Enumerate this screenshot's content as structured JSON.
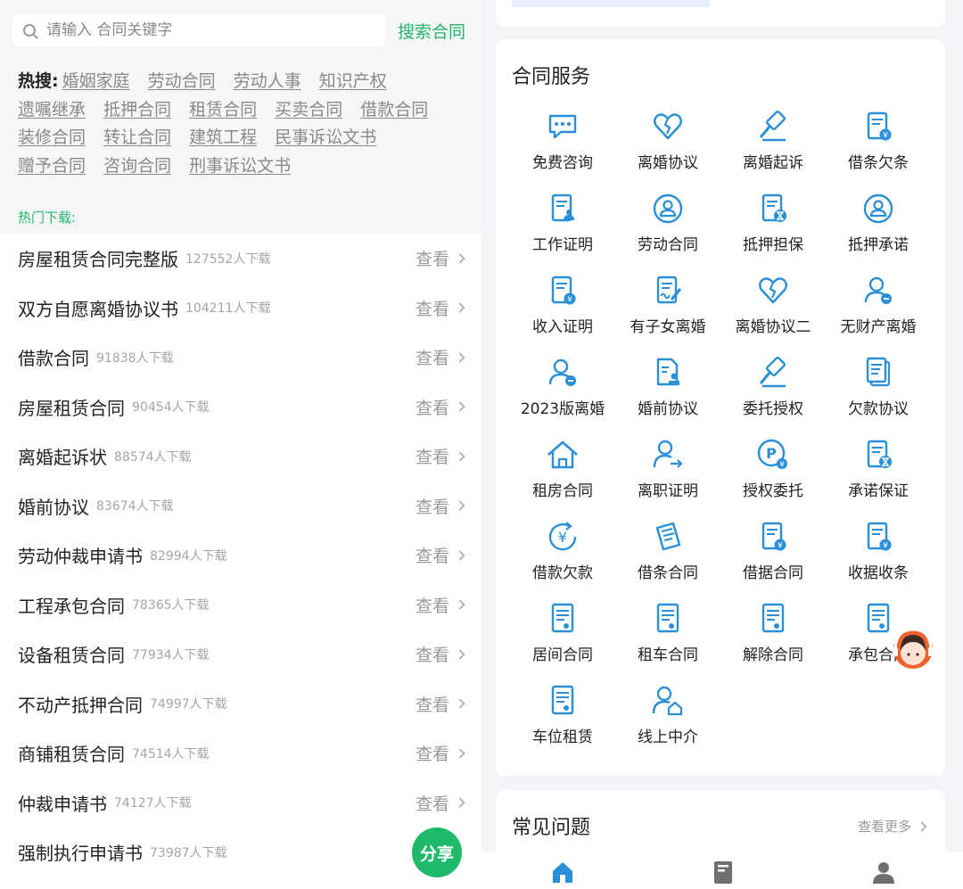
{
  "search": {
    "placeholder": "请输入 合同关键字",
    "button": "搜索合同"
  },
  "hot_search": {
    "label": "热搜:",
    "tags": [
      "婚姻家庭",
      "劳动合同",
      "劳动人事",
      "知识产权",
      "遗嘱继承",
      "抵押合同",
      "租赁合同",
      "买卖合同",
      "借款合同",
      "装修合同",
      "转让合同",
      "建筑工程",
      "民事诉讼文书",
      "赠予合同",
      "咨询合同",
      "刑事诉讼文书"
    ]
  },
  "hot_downloads": {
    "label": "热门下载:",
    "view_label": "查看",
    "items": [
      {
        "title": "房屋租赁合同完整版",
        "count": "127552人下载"
      },
      {
        "title": "双方自愿离婚协议书",
        "count": "104211人下载"
      },
      {
        "title": "借款合同",
        "count": "91838人下载"
      },
      {
        "title": "房屋租赁合同",
        "count": "90454人下载"
      },
      {
        "title": "离婚起诉状",
        "count": "88574人下载"
      },
      {
        "title": "婚前协议",
        "count": "83674人下载"
      },
      {
        "title": "劳动仲裁申请书",
        "count": "82994人下载"
      },
      {
        "title": "工程承包合同",
        "count": "78365人下载"
      },
      {
        "title": "设备租赁合同",
        "count": "77934人下载"
      },
      {
        "title": "不动产抵押合同",
        "count": "74997人下载"
      },
      {
        "title": "商铺租赁合同",
        "count": "74514人下载"
      },
      {
        "title": "仲裁申请书",
        "count": "74127人下载"
      },
      {
        "title": "强制执行申请书",
        "count": "73987人下载"
      }
    ],
    "share_label": "分享"
  },
  "contract_services": {
    "title": "合同服务",
    "items": [
      {
        "label": "免费咨询",
        "icon": "chat-icon"
      },
      {
        "label": "离婚协议",
        "icon": "broken-heart-icon"
      },
      {
        "label": "离婚起诉",
        "icon": "gavel-icon"
      },
      {
        "label": "借条欠条",
        "icon": "yen-document-icon"
      },
      {
        "label": "工作证明",
        "icon": "person-document-icon"
      },
      {
        "label": "劳动合同",
        "icon": "person-circle-icon"
      },
      {
        "label": "抵押担保",
        "icon": "hourglass-document-icon"
      },
      {
        "label": "抵押承诺",
        "icon": "person-circle-icon"
      },
      {
        "label": "收入证明",
        "icon": "yen-document-icon"
      },
      {
        "label": "有子女离婚",
        "icon": "signature-document-icon"
      },
      {
        "label": "离婚协议二",
        "icon": "broken-heart-icon"
      },
      {
        "label": "无财产离婚",
        "icon": "person-minus-icon"
      },
      {
        "label": "2023版离婚",
        "icon": "person-minus-icon"
      },
      {
        "label": "婚前协议",
        "icon": "stamp-document-icon"
      },
      {
        "label": "委托授权",
        "icon": "gavel-icon"
      },
      {
        "label": "欠款协议",
        "icon": "stacked-document-icon"
      },
      {
        "label": "租房合同",
        "icon": "house-icon"
      },
      {
        "label": "离职证明",
        "icon": "person-exit-icon"
      },
      {
        "label": "授权委托",
        "icon": "parking-icon"
      },
      {
        "label": "承诺保证",
        "icon": "hourglass-document-icon"
      },
      {
        "label": "借款欠款",
        "icon": "yen-cycle-icon"
      },
      {
        "label": "借条合同",
        "icon": "receipt-icon"
      },
      {
        "label": "借据合同",
        "icon": "yen-document-icon"
      },
      {
        "label": "收据收条",
        "icon": "yen-document-icon"
      },
      {
        "label": "居间合同",
        "icon": "certificate-icon"
      },
      {
        "label": "租车合同",
        "icon": "certificate-icon"
      },
      {
        "label": "解除合同",
        "icon": "certificate-icon"
      },
      {
        "label": "承包合同",
        "icon": "certificate-icon"
      },
      {
        "label": "车位租赁",
        "icon": "certificate-icon"
      },
      {
        "label": "线上中介",
        "icon": "person-house-icon"
      }
    ]
  },
  "faq": {
    "title": "常见问题",
    "more": "查看更多"
  },
  "tabbar": {
    "items": [
      {
        "icon": "home-icon",
        "active": true
      },
      {
        "icon": "book-icon",
        "active": false
      },
      {
        "icon": "user-icon",
        "active": false
      }
    ]
  },
  "colors": {
    "accent_green": "#24b56a",
    "icon_blue": "#2a8fd8",
    "agent_orange": "#f0622d"
  }
}
